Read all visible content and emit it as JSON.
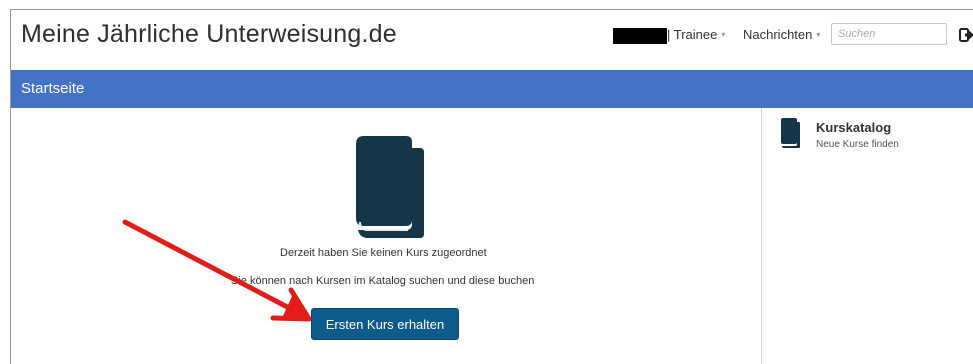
{
  "header": {
    "site_title": "Meine Jährliche Unterweisung.de",
    "user_role": "| Trainee",
    "messages_label": "Nachrichten",
    "search_placeholder": "Suchen"
  },
  "bluebar": {
    "title": "Startseite"
  },
  "main": {
    "empty_message": "Derzeit haben Sie keinen Kurs zugeordnet",
    "hint_message": "Sie können nach Kursen im Katalog suchen und diese buchen",
    "cta_label": "Ersten Kurs erhalten"
  },
  "sidebar": {
    "catalog_title": "Kurskatalog",
    "catalog_subtitle": "Neue Kurse finden"
  },
  "colors": {
    "blue_bar": "#4472c4",
    "cta_button": "#0e5a8a",
    "book_icon": "#153548",
    "annotation_arrow": "#e21b1b"
  },
  "icons": [
    "book-icon",
    "logout-icon",
    "chevron-down-icon",
    "red-arrow-annotation"
  ]
}
